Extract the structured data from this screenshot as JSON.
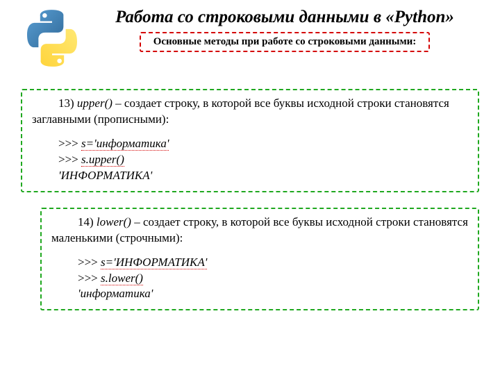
{
  "header": {
    "title": "Работа со строковыми данными в «Python»",
    "subtitle": "Основные методы при работе со строковыми данными:"
  },
  "methods": [
    {
      "num": "13)",
      "name": "upper()",
      "desc_tail": " – создает строку, в которой все буквы исходной строки становятся заглавными (прописными):",
      "code1_prompt": ">>> ",
      "code1_text": "s='информатика'",
      "code2_prompt": ">>> ",
      "code2_text": "s.upper()",
      "result": "'ИНФОРМАТИКА'"
    },
    {
      "num": "14)",
      "name": "lower()",
      "desc_tail": " – создает строку, в которой все буквы исходной строки становятся маленькими (строчными):",
      "code1_prompt": ">>> ",
      "code1_text": "s='ИНФОРМАТИКА'",
      "code2_prompt": ">>> ",
      "code2_text": "s.lower()",
      "result": "'информатика'"
    }
  ]
}
